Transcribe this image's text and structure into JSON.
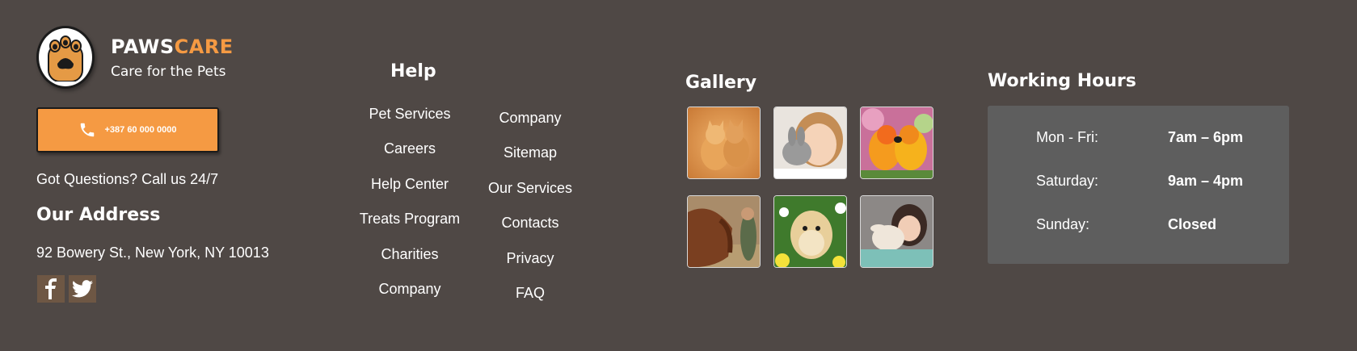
{
  "brand": {
    "name_part1": "PAWS",
    "name_part2": "CARE",
    "tagline": "Care for the Pets",
    "accent_color": "#f59a43",
    "logo_icon": "paw-icon"
  },
  "contact": {
    "phone": "+387 60 000 0000",
    "phone_icon": "phone-icon",
    "questions": "Got Questions? Call us 24/7",
    "address_title": "Our Address",
    "address": "92 Bowery St., New York, NY 10013"
  },
  "social": [
    {
      "icon": "facebook-icon"
    },
    {
      "icon": "twitter-icon"
    }
  ],
  "help": {
    "title": "Help",
    "col1": [
      "Pet Services",
      "Careers",
      "Help Center",
      "Treats Program",
      "Charities",
      "Company"
    ],
    "col2": [
      "Company",
      "Sitemap",
      "Our Services",
      "Contacts",
      "Privacy",
      "FAQ"
    ]
  },
  "gallery": {
    "title": "Gallery",
    "images": [
      "kittens-photo",
      "girl-with-rabbit-photo",
      "parrots-photo",
      "horse-photo",
      "hamster-photo",
      "girl-with-lamb-photo"
    ]
  },
  "hours": {
    "title": "Working Hours",
    "rows": [
      {
        "day": "Mon - Fri:",
        "time": "7am – 6pm"
      },
      {
        "day": "Saturday:",
        "time": "9am – 4pm"
      },
      {
        "day": "Sunday:",
        "time": "Closed"
      }
    ]
  },
  "colors": {
    "background": "#4f4845",
    "panel": "#5e5e5e",
    "social_bg": "#6e5744"
  }
}
